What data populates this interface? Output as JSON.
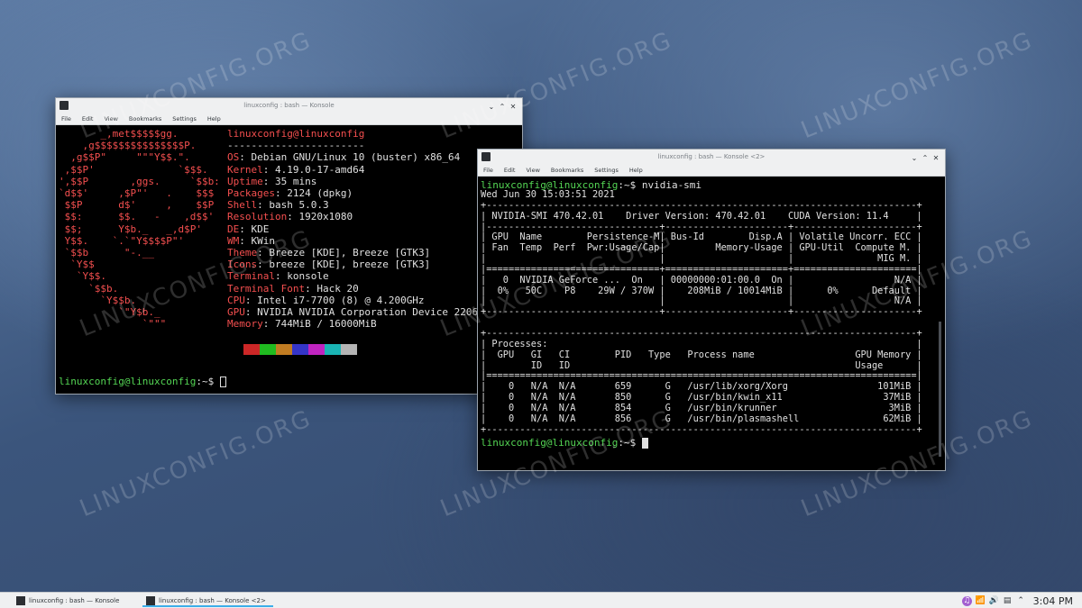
{
  "watermark": "LINUXCONFIG.ORG",
  "window1": {
    "title": "linuxconfig : bash — Konsole",
    "menu": [
      "File",
      "Edit",
      "View",
      "Bookmarks",
      "Settings",
      "Help"
    ],
    "logo_lines": [
      "       _,met$$$$$gg.",
      "    ,g$$$$$$$$$$$$$$$P.",
      "  ,g$$P\"     \"\"\"Y$$.\".",
      " ,$$P'              `$$$.",
      "',$$P       ,ggs.     `$$b:",
      "`d$$'     ,$P\"'   .    $$$",
      " $$P      d$'     ,    $$P",
      " $$:      $$.   -    ,d$$'",
      " $$;      Y$b._   _,d$P'",
      " Y$$.    `.`\"Y$$$$P\"'",
      " `$$b      \"-.__",
      "  `Y$$",
      "   `Y$$.",
      "     `$$b.",
      "       `Y$$b.",
      "          `\"Y$b._",
      "              `\"\"\""
    ],
    "header": "linuxconfig@linuxconfig",
    "separator": "-----------------------",
    "info": [
      {
        "key": "OS",
        "value": "Debian GNU/Linux 10 (buster) x86_64"
      },
      {
        "key": "Kernel",
        "value": "4.19.0-17-amd64"
      },
      {
        "key": "Uptime",
        "value": "35 mins"
      },
      {
        "key": "Packages",
        "value": "2124 (dpkg)"
      },
      {
        "key": "Shell",
        "value": "bash 5.0.3"
      },
      {
        "key": "Resolution",
        "value": "1920x1080"
      },
      {
        "key": "DE",
        "value": "KDE"
      },
      {
        "key": "WM",
        "value": "KWin"
      },
      {
        "key": "Theme",
        "value": "Breeze [KDE], Breeze [GTK3]"
      },
      {
        "key": "Icons",
        "value": "breeze [KDE], breeze [GTK3]"
      },
      {
        "key": "Terminal",
        "value": "konsole"
      },
      {
        "key": "Terminal Font",
        "value": "Hack 20"
      },
      {
        "key": "CPU",
        "value": "Intel i7-7700 (8) @ 4.200GHz"
      },
      {
        "key": "GPU",
        "value": "NVIDIA NVIDIA Corporation Device 2206"
      },
      {
        "key": "Memory",
        "value": "744MiB / 16000MiB"
      }
    ],
    "palette": [
      "#000000",
      "#cc2727",
      "#20bb20",
      "#c17c22",
      "#3535c8",
      "#c024c0",
      "#1ab4b4",
      "#b4b4b4"
    ],
    "prompt_user": "linuxconfig@linuxconfig",
    "prompt_path": ":~$ "
  },
  "window2": {
    "title": "linuxconfig : bash — Konsole <2>",
    "menu": [
      "File",
      "Edit",
      "View",
      "Bookmarks",
      "Settings",
      "Help"
    ],
    "prompt_user": "linuxconfig@linuxconfig",
    "prompt_path": ":~$ ",
    "command": "nvidia-smi",
    "output": [
      "Wed Jun 30 15:03:51 2021",
      "+-----------------------------------------------------------------------------+",
      "| NVIDIA-SMI 470.42.01    Driver Version: 470.42.01    CUDA Version: 11.4     |",
      "|-------------------------------+----------------------+----------------------+",
      "| GPU  Name        Persistence-M| Bus-Id        Disp.A | Volatile Uncorr. ECC |",
      "| Fan  Temp  Perf  Pwr:Usage/Cap|         Memory-Usage | GPU-Util  Compute M. |",
      "|                               |                      |               MIG M. |",
      "|===============================+======================+======================|",
      "|   0  NVIDIA GeForce ...  On   | 00000000:01:00.0  On |                  N/A |",
      "|  0%   50C    P8    29W / 370W |    208MiB / 10014MiB |      0%      Default |",
      "|                               |                      |                  N/A |",
      "+-------------------------------+----------------------+----------------------+",
      "",
      "+-----------------------------------------------------------------------------+",
      "| Processes:                                                                  |",
      "|  GPU   GI   CI        PID   Type   Process name                  GPU Memory |",
      "|        ID   ID                                                   Usage      |",
      "|=============================================================================|",
      "|    0   N/A  N/A       659      G   /usr/lib/xorg/Xorg                101MiB |",
      "|    0   N/A  N/A       850      G   /usr/bin/kwin_x11                  37MiB |",
      "|    0   N/A  N/A       854      G   /usr/bin/krunner                    3MiB |",
      "|    0   N/A  N/A       856      G   /usr/bin/plasmashell               62MiB |",
      "+-----------------------------------------------------------------------------+"
    ]
  },
  "taskbar": {
    "tasks": [
      "linuxconfig : bash — Konsole",
      "linuxconfig : bash — Konsole <2>"
    ],
    "clock": "3:04 PM"
  }
}
